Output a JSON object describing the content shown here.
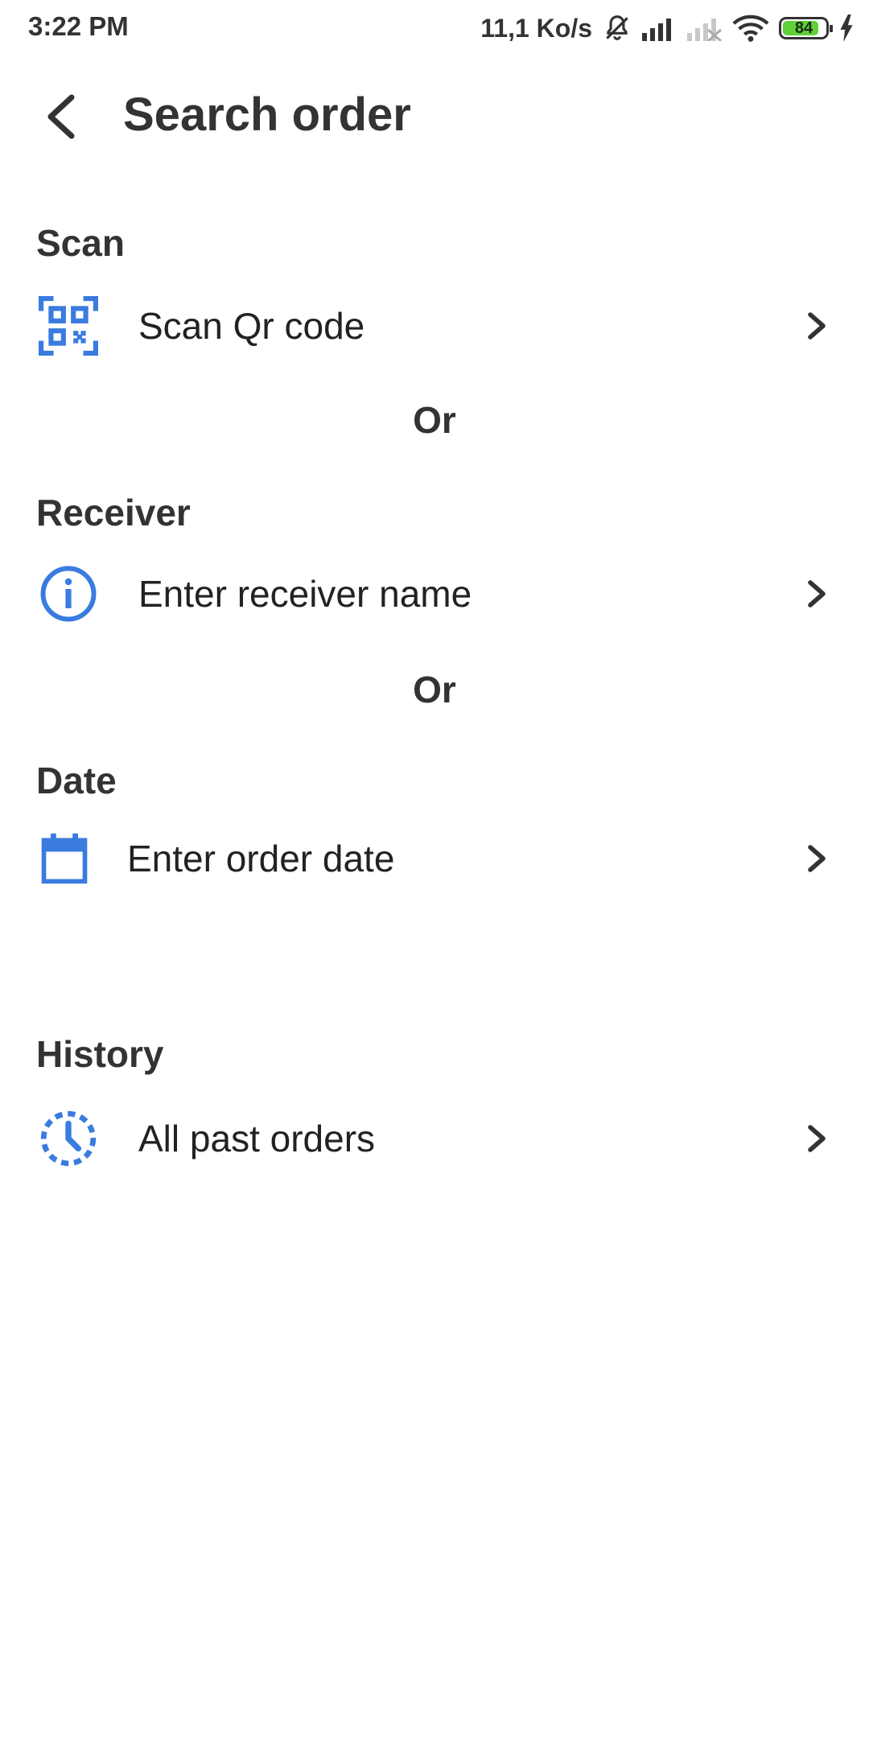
{
  "status_bar": {
    "time": "3:22 PM",
    "net_speed": "11,1 Ko/s",
    "battery_level": "84",
    "battery_fraction": 0.84,
    "icons": [
      "bell-muted-icon",
      "signal-icon",
      "signal-empty-icon",
      "wifi-icon",
      "battery-icon",
      "charging-icon"
    ]
  },
  "header": {
    "title": "Search order",
    "back_icon": "back-arrow-icon"
  },
  "sections": {
    "scan": {
      "label": "Scan",
      "item_label": "Scan Qr code",
      "icon": "qr-code-icon"
    },
    "or1": "Or",
    "receiver": {
      "label": "Receiver",
      "item_label": "Enter receiver name",
      "icon": "info-icon"
    },
    "or2": "Or",
    "date": {
      "label": "Date",
      "item_label": "Enter order date",
      "icon": "calendar-icon"
    },
    "history": {
      "label": "History",
      "item_label": "All past orders",
      "icon": "history-clock-icon"
    }
  },
  "colors": {
    "accent": "#3a7be0",
    "text": "#333333",
    "battery_fill": "#5fcf3a"
  }
}
